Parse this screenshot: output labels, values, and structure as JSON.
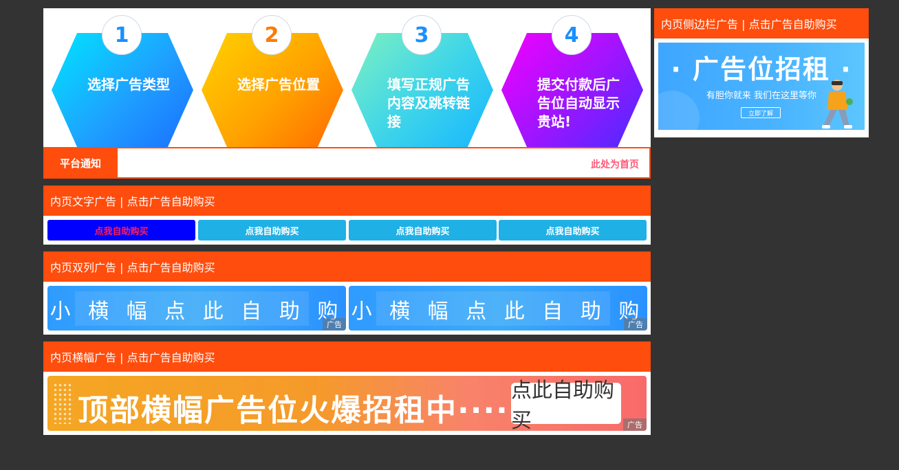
{
  "steps": [
    {
      "number": "1",
      "text": "选择广告类型"
    },
    {
      "number": "2",
      "text": "选择广告位置"
    },
    {
      "number": "3",
      "text": "填写正规广告内容及跳转链接"
    },
    {
      "number": "4",
      "text": "提交付款后广告位自动显示贵站!"
    }
  ],
  "notice": {
    "label": "平台通知",
    "marquee": "此处为首页"
  },
  "text_ads": {
    "header": "内页文字广告 | 点击广告自助购买",
    "items": [
      "点我自助购买",
      "点我自助购买",
      "点我自助购买",
      "点我自助购买"
    ]
  },
  "dual_ads": {
    "header": "内页双列广告 | 点击广告自助购买",
    "items": [
      {
        "text": "小 横 幅   点 此 自 助 购 买",
        "tag": "广告"
      },
      {
        "text": "小 横 幅   点 此 自 助 购 买",
        "tag": "广告"
      }
    ]
  },
  "banner_ad": {
    "header": "内页横幅广告 | 点击广告自助购买",
    "text": "顶部横幅广告位火爆招租中······",
    "button": "点此自助购买",
    "tag": "广告"
  },
  "sidebar_ad": {
    "header": "内页侧边栏广告 | 点击广告自助购买",
    "title": "· 广告位招租 ·",
    "subtitle": "有胆你就来 我们在这里等你",
    "button": "立即了解"
  },
  "colors": {
    "background": "#333333",
    "accent": "#ff4d0d",
    "text_ad_blue": "#1fb0e6",
    "text_ad_highlight": "#0000ff"
  }
}
